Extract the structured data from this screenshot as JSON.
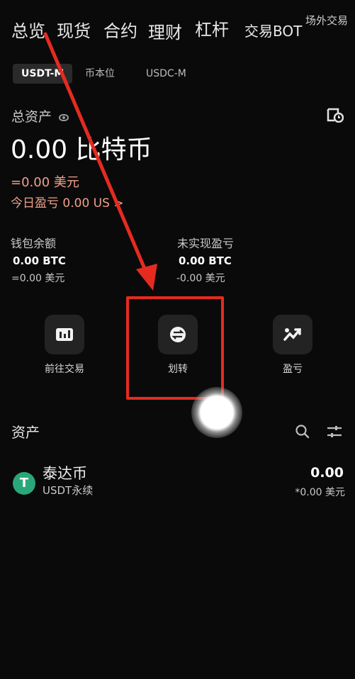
{
  "top_tabs": [
    "总览",
    "现货",
    "合约",
    "理财",
    "杠杆",
    "交易BOT",
    "场外交易"
  ],
  "unit_tabs": [
    "USDT-M",
    "币本位",
    "USDC-M"
  ],
  "overview": {
    "total_assets_label": "总资产",
    "total_value": "0.00 比特币",
    "fiat_value": "=0.00 美元",
    "today_pnl": "今日盈亏 0.00 US >"
  },
  "wallet": {
    "balance_label": "钱包余额",
    "balance_btc": "0.00 BTC",
    "balance_fiat": "=0.00 美元",
    "unrealized_label": "未实现盈亏",
    "unrealized_btc": "0.00 BTC",
    "unrealized_fiat": "-0.00 美元"
  },
  "actions": [
    "前往交易",
    "划转",
    "盈亏"
  ],
  "assets_section": {
    "title": "资产",
    "items": [
      {
        "name": "泰达币",
        "sub": "USDT永续",
        "amount": "0.00",
        "fiat": "*0.00 美元",
        "icon_letter": "T"
      }
    ]
  },
  "colors": {
    "highlight": "#e52b20",
    "accent_orange": "#f0a08a",
    "tether": "#2aa77a"
  }
}
